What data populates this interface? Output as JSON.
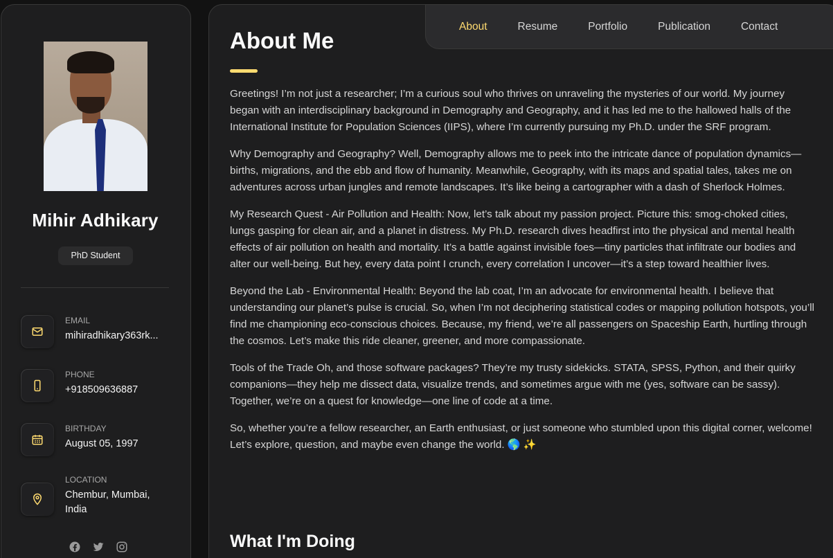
{
  "profile": {
    "name": "Mihir Adhikary",
    "role": "PhD Student"
  },
  "contacts": [
    {
      "label": "EMAIL",
      "value": "mihiradhikary363rk...",
      "icon": "mail-icon"
    },
    {
      "label": "PHONE",
      "value": "+918509636887",
      "icon": "phone-icon"
    },
    {
      "label": "BIRTHDAY",
      "value": "August 05, 1997",
      "icon": "calendar-icon"
    },
    {
      "label": "LOCATION",
      "value": "Chembur, Mumbai, India",
      "icon": "location-pin-icon"
    }
  ],
  "socials": [
    "facebook-icon",
    "twitter-icon",
    "instagram-icon"
  ],
  "nav": {
    "items": [
      "About",
      "Resume",
      "Portfolio",
      "Publication",
      "Contact"
    ],
    "active": "About"
  },
  "main": {
    "title": "About Me",
    "paragraphs": [
      "Greetings! I’m not just a researcher; I’m a curious soul who thrives on unraveling the mysteries of our world. My journey began with an interdisciplinary background in Demography and Geography, and it has led me to the hallowed halls of the International Institute for Population Sciences (IIPS), where I’m currently pursuing my Ph.D. under the SRF program.",
      "Why Demography and Geography? Well, Demography allows me to peek into the intricate dance of population dynamics—births, migrations, and the ebb and flow of humanity. Meanwhile, Geography, with its maps and spatial tales, takes me on adventures across urban jungles and remote landscapes. It’s like being a cartographer with a dash of Sherlock Holmes.",
      "My Research Quest - Air Pollution and Health: Now, let’s talk about my passion project. Picture this: smog-choked cities, lungs gasping for clean air, and a planet in distress. My Ph.D. research dives headfirst into the physical and mental health effects of air pollution on health and mortality. It’s a battle against invisible foes—tiny particles that infiltrate our bodies and alter our well-being. But hey, every data point I crunch, every correlation I uncover—it’s a step toward healthier lives.",
      "Beyond the Lab - Environmental Health: Beyond the lab coat, I’m an advocate for environmental health. I believe that understanding our planet’s pulse is crucial. So, when I’m not deciphering statistical codes or mapping pollution hotspots, you’ll find me championing eco-conscious choices. Because, my friend, we’re all passengers on Spaceship Earth, hurtling through the cosmos. Let’s make this ride cleaner, greener, and more compassionate.",
      "Tools of the Trade Oh, and those software packages? They’re my trusty sidekicks. STATA, SPSS, Python, and their quirky companions—they help me dissect data, visualize trends, and sometimes argue with me (yes, software can be sassy). Together, we’re on a quest for knowledge—one line of code at a time.",
      "So, whether you’re a fellow researcher, an Earth enthusiast, or just someone who stumbled upon this digital corner, welcome! Let’s explore, question, and maybe even change the world. 🌎 ✨"
    ],
    "section_title": "What I'm Doing"
  },
  "colors": {
    "accent": "#ffdb70",
    "background": "#121212",
    "card": "#1e1e1f",
    "border": "#383838"
  }
}
